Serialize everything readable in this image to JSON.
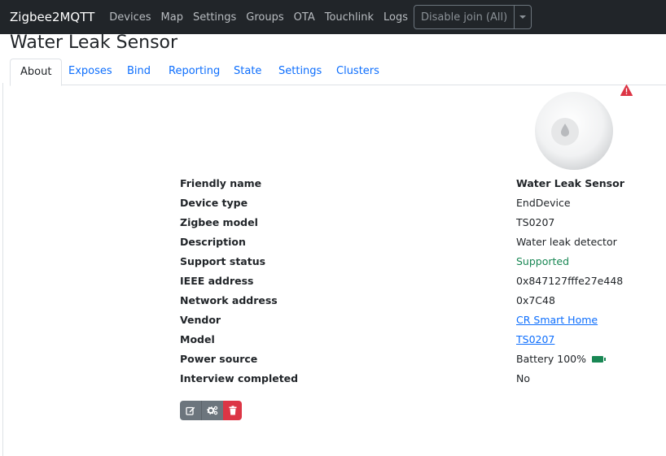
{
  "navbar": {
    "brand": "Zigbee2MQTT",
    "links": [
      "Devices",
      "Map",
      "Settings",
      "Groups",
      "OTA",
      "Touchlink",
      "Logs"
    ],
    "join_button": "Disable join (All)"
  },
  "page": {
    "title": "Water Leak Sensor"
  },
  "tabs": [
    "About",
    "Exposes",
    "Bind",
    "Reporting",
    "State",
    "Settings",
    "Clusters"
  ],
  "active_tab": "About",
  "device_info": {
    "friendly_name_label": "Friendly name",
    "friendly_name": "Water Leak Sensor",
    "device_type_label": "Device type",
    "device_type": "EndDevice",
    "zigbee_model_label": "Zigbee model",
    "zigbee_model": "TS0207",
    "description_label": "Description",
    "description": "Water leak detector",
    "support_status_label": "Support status",
    "support_status": "Supported",
    "ieee_address_label": "IEEE address",
    "ieee_address": "0x847127fffe27e448",
    "network_address_label": "Network address",
    "network_address": "0x7C48",
    "vendor_label": "Vendor",
    "vendor": "CR Smart Home",
    "model_label": "Model",
    "model": "TS0207",
    "power_source_label": "Power source",
    "power_source": "Battery 100%",
    "battery_level": 1.0,
    "interview_completed_label": "Interview completed",
    "interview_completed": "No"
  },
  "icons": {
    "warning": "warning-triangle-icon",
    "edit": "edit-icon",
    "configure": "gears-icon",
    "delete": "trash-icon",
    "battery": "battery-full-icon"
  },
  "colors": {
    "navbar_bg": "#212529",
    "link": "#0d6efd",
    "supported": "#198754",
    "danger": "#dc3545",
    "secondary": "#6c757d"
  }
}
